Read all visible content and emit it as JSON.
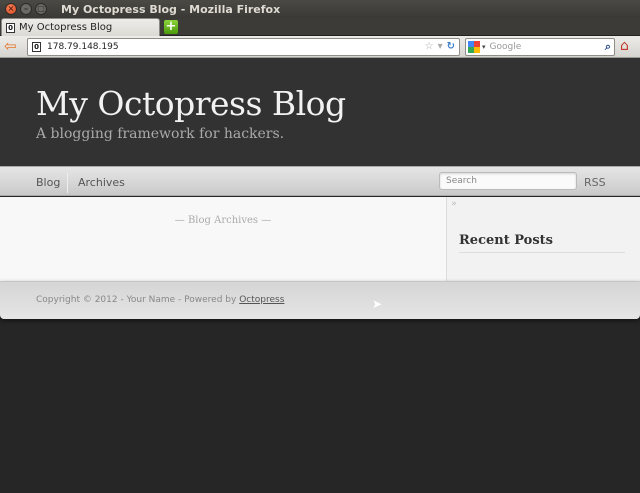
{
  "window": {
    "title": "My Octopress Blog - Mozilla Firefox"
  },
  "tab": {
    "label": "My Octopress Blog",
    "favicon": "0"
  },
  "addressbar": {
    "url": "178.79.148.195",
    "favicon": "0"
  },
  "searchbar": {
    "placeholder": "Google"
  },
  "site": {
    "title": "My Octopress Blog",
    "subtitle": "A blogging framework for hackers."
  },
  "nav": {
    "items": [
      {
        "label": "Blog"
      },
      {
        "label": "Archives"
      }
    ],
    "search_placeholder": "Search",
    "rss": "RSS"
  },
  "main": {
    "heading": "— Blog Archives —"
  },
  "sidebar": {
    "collapse": "»",
    "recent_posts": "Recent Posts"
  },
  "footer": {
    "text": "Copyright © 2012 - Your Name - Powered by ",
    "link": "Octopress"
  }
}
